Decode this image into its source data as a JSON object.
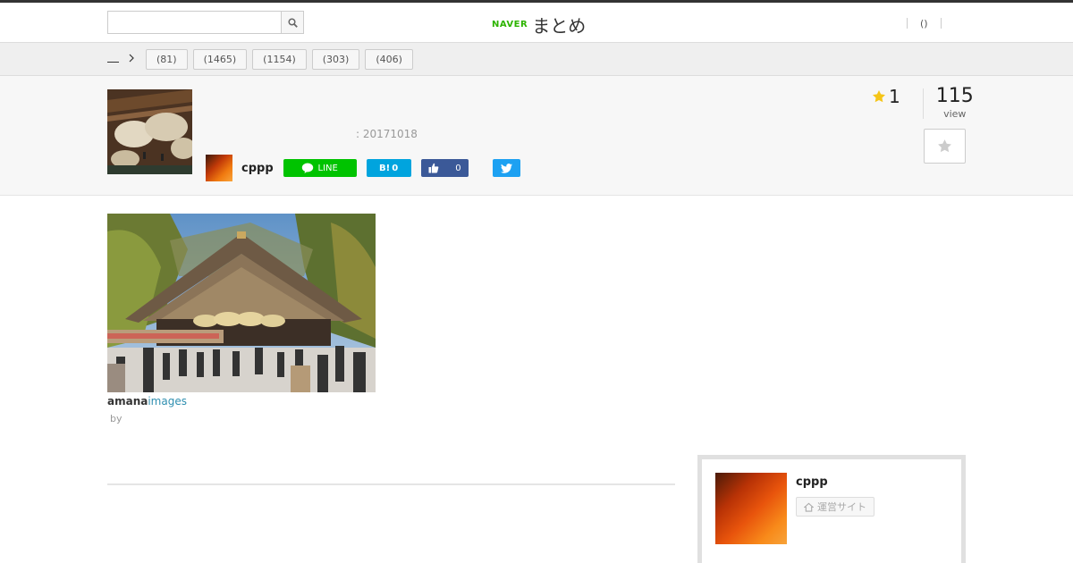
{
  "topbar": {
    "search_value": "",
    "logo_naver": "NAVER",
    "logo_matome": "まとめ",
    "login_link": "()"
  },
  "categories": {
    "chips": [
      {
        "label": "(81)"
      },
      {
        "label": "(1465)"
      },
      {
        "label": "(1154)"
      },
      {
        "label": "(303)"
      },
      {
        "label": "(406)"
      }
    ]
  },
  "article": {
    "date": ": 20171018",
    "author": "cppp",
    "share": {
      "line_label": "LINE",
      "hatena_label": "B!",
      "hatena_count": "0",
      "fb_count": "0"
    },
    "favorites": "1",
    "views": "115",
    "views_label": "view"
  },
  "content": {
    "credit_a": "amana",
    "credit_b": "images",
    "by": "by"
  },
  "profile": {
    "name": "cppp",
    "site_label": "運営サイト"
  },
  "colors": {
    "line": "#00c300",
    "hatena": "#00a4de",
    "facebook": "#3b5998",
    "twitter": "#1da1f2",
    "naver": "#2db400",
    "star": "#f5c518"
  }
}
